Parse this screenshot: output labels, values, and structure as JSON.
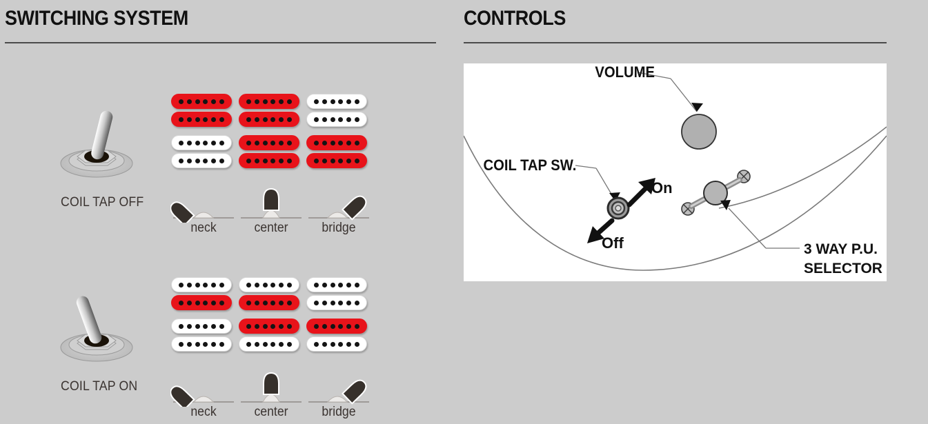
{
  "sections": {
    "left_title": "SWITCHING SYSTEM",
    "right_title": "CONTROLS"
  },
  "switching_system": {
    "modes": [
      {
        "toggle_label": "COIL TAP OFF",
        "toggle_state": "off",
        "toggle_lean": "right",
        "positions": [
          {
            "name": "neck",
            "label": "neck",
            "pickups": [
              {
                "slot": "neck",
                "coils": [
                  "red",
                  "red"
                ]
              },
              {
                "slot": "bridge",
                "coils": [
                  "white",
                  "white"
                ]
              }
            ]
          },
          {
            "name": "center",
            "label": "center",
            "pickups": [
              {
                "slot": "neck",
                "coils": [
                  "red",
                  "red"
                ]
              },
              {
                "slot": "bridge",
                "coils": [
                  "red",
                  "red"
                ]
              }
            ]
          },
          {
            "name": "bridge",
            "label": "bridge",
            "pickups": [
              {
                "slot": "neck",
                "coils": [
                  "white",
                  "white"
                ]
              },
              {
                "slot": "bridge",
                "coils": [
                  "red",
                  "red"
                ]
              }
            ]
          }
        ]
      },
      {
        "toggle_label": "COIL TAP ON",
        "toggle_state": "on",
        "toggle_lean": "left",
        "positions": [
          {
            "name": "neck",
            "label": "neck",
            "pickups": [
              {
                "slot": "neck",
                "coils": [
                  "white",
                  "red"
                ]
              },
              {
                "slot": "bridge",
                "coils": [
                  "white",
                  "white"
                ]
              }
            ]
          },
          {
            "name": "center",
            "label": "center",
            "pickups": [
              {
                "slot": "neck",
                "coils": [
                  "white",
                  "red"
                ]
              },
              {
                "slot": "bridge",
                "coils": [
                  "red",
                  "white"
                ]
              }
            ]
          },
          {
            "name": "bridge",
            "label": "bridge",
            "pickups": [
              {
                "slot": "neck",
                "coils": [
                  "white",
                  "white"
                ]
              },
              {
                "slot": "bridge",
                "coils": [
                  "red",
                  "white"
                ]
              }
            ]
          }
        ]
      }
    ]
  },
  "controls": {
    "callouts": {
      "volume": "VOLUME",
      "coil_tap_sw": "COIL TAP SW.",
      "selector_line1": "3 WAY P.U.",
      "selector_line2": "SELECTOR",
      "on": "On",
      "off": "Off"
    }
  },
  "colors": {
    "background": "#cccccc",
    "coil_active": "#e8131a",
    "coil_inactive": "#ffffff",
    "pole": "#141414",
    "rule": "#4a4a4a",
    "text": "#3a3330",
    "heading": "#111111",
    "panel": "#ffffff",
    "knob": "#b0b0b0"
  }
}
